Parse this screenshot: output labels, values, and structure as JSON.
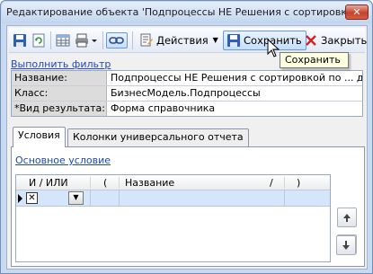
{
  "window": {
    "title": "Редактирование объекта 'Подпроцессы НЕ Решения с сортировко...",
    "close_glyph": "✕"
  },
  "toolbar": {
    "actions_label": "Действия",
    "save_label": "Сохранить",
    "close_label": "Закрыть",
    "icons": [
      "save-icon",
      "refresh-icon",
      "table-icon",
      "print-icon",
      "link-icon",
      "actions-icon",
      "save-icon",
      "close-icon"
    ]
  },
  "filter": {
    "label": "Выполнить фильтр"
  },
  "form": {
    "name": {
      "label": "Название:",
      "value": "Подпроцессы НЕ Решения с сортировкой по ... ду"
    },
    "class": {
      "label": "Класс:",
      "value": "БизнесМодель.Подпроцессы"
    },
    "result_type": {
      "label": "*Вид результата:",
      "value": "Форма справочника"
    }
  },
  "tooltip": {
    "text": "Сохранить"
  },
  "tabs": {
    "conditions": "Условия",
    "report_columns": "Колонки универсального отчета"
  },
  "conditions": {
    "main_condition_link": "Основное условие",
    "grid": {
      "headers": {
        "and_or": "И / ИЛИ",
        "open_paren": "(",
        "name": "Название",
        "slash": "/",
        "close_paren": ")"
      },
      "rows": [
        {
          "checkbox": "✕",
          "combo_glyph": "▼"
        }
      ]
    }
  },
  "colors": {
    "accent_link": "#1e47b4",
    "selection_row": "#d5e6fb",
    "tooltip_bg": "#ffffe1",
    "close_red": "#c7412a"
  }
}
